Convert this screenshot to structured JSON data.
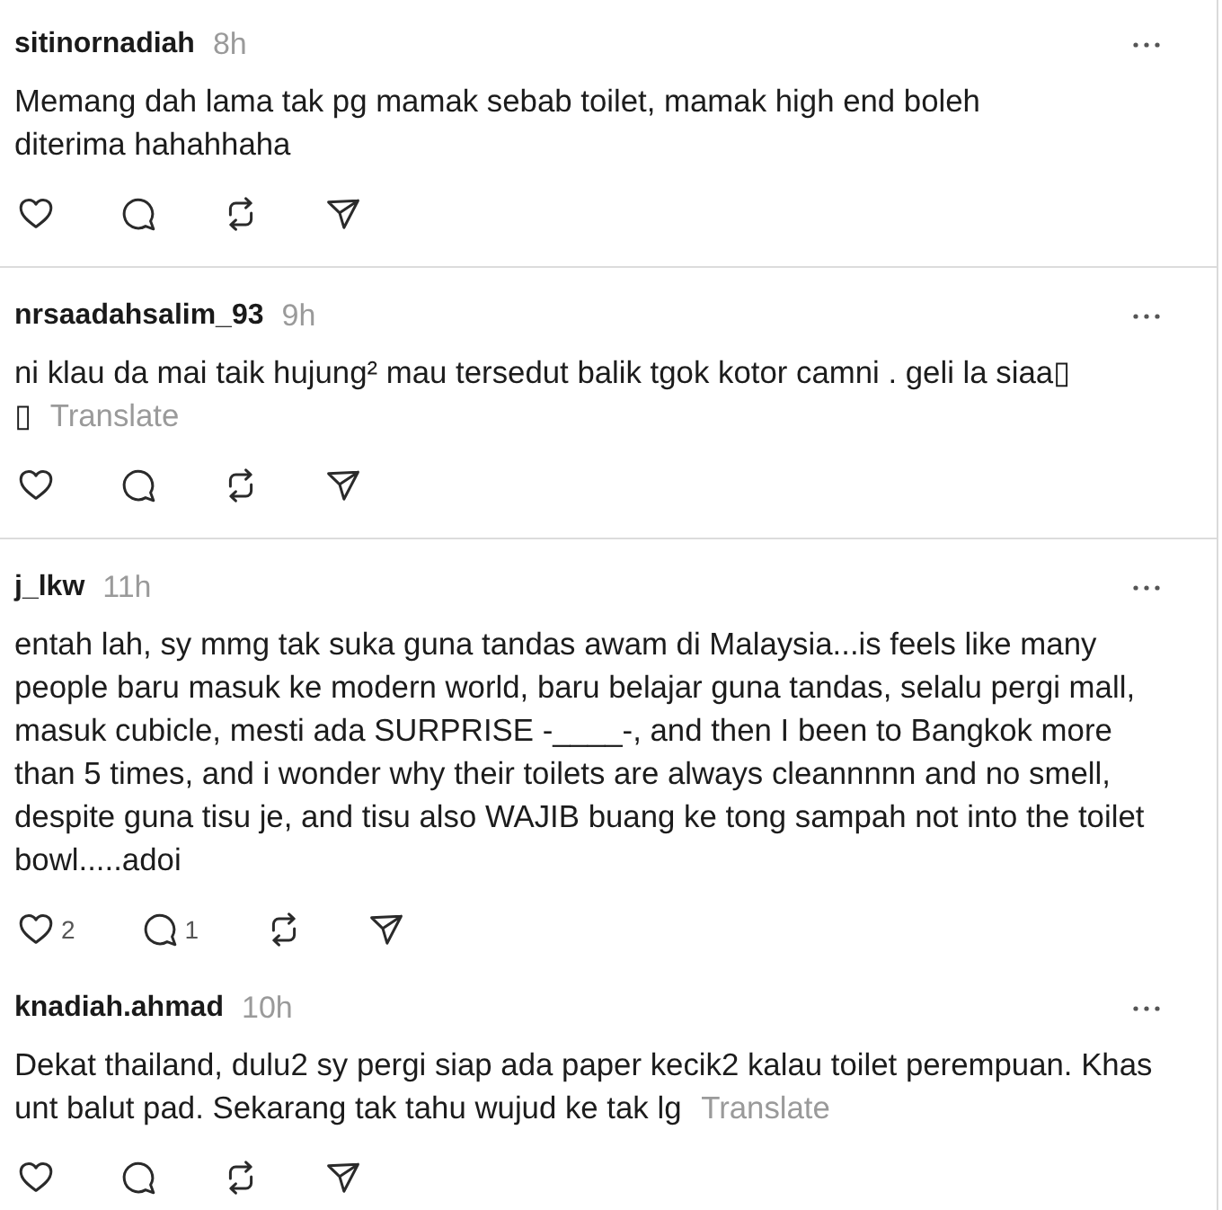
{
  "posts": [
    {
      "username": "sitinornadiah",
      "time": "8h",
      "text": "Memang dah lama tak pg mamak sebab toilet, mamak high end boleh\nditerima hahahhaha",
      "actions": [
        {
          "kind": "like"
        },
        {
          "kind": "reply"
        },
        {
          "kind": "repost"
        },
        {
          "kind": "share"
        }
      ],
      "divider": true
    },
    {
      "username": "nrsaadahsalim_93",
      "time": "9h",
      "text": "ni klau da mai taik hujung² mau tersedut balik tgok kotor camni . geli la siaa▯\n▯",
      "translate": "Translate",
      "actions": [
        {
          "kind": "like"
        },
        {
          "kind": "reply"
        },
        {
          "kind": "repost"
        },
        {
          "kind": "share"
        }
      ],
      "divider": true
    },
    {
      "username": "j_lkw",
      "time": "11h",
      "text": "entah lah, sy mmg tak suka guna tandas awam di Malaysia...is feels like many people baru masuk ke modern world, baru belajar guna tandas, selalu pergi mall, masuk cubicle, mesti ada SURPRISE -____-, and then I been to Bangkok more than 5 times, and i wonder why their toilets are always cleannnnn and no smell, despite guna tisu je, and tisu also WAJIB buang ke tong sampah not into the toilet bowl.....adoi",
      "actions": [
        {
          "kind": "like",
          "count": "2"
        },
        {
          "kind": "reply",
          "count": "1"
        },
        {
          "kind": "repost"
        },
        {
          "kind": "share"
        }
      ],
      "divider": false
    },
    {
      "username": "knadiah.ahmad",
      "time": "10h",
      "text": "Dekat thailand, dulu2 sy pergi siap ada paper kecik2 kalau toilet perempuan. Khas unt balut pad. Sekarang tak tahu wujud ke tak lg",
      "translate": "Translate",
      "actions": [
        {
          "kind": "like"
        },
        {
          "kind": "reply"
        },
        {
          "kind": "repost"
        },
        {
          "kind": "share"
        }
      ],
      "divider": false
    }
  ]
}
